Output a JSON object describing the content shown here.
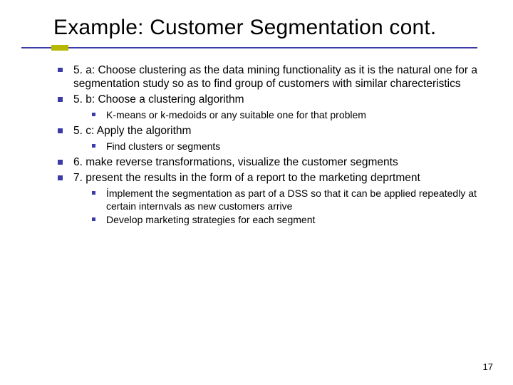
{
  "title": "Example: Customer Segmentation cont.",
  "bullets": {
    "b1": "5. a: Choose clustering as the data mining functionality as it is the natural one for a segmentation study so as to find group of customers with similar charecteristics",
    "b2": "5. b: Choose a clustering algorithm",
    "b2_1": "K-means or k-medoids or any suitable one for that problem",
    "b3": "5. c: Apply the algorithm",
    "b3_1": "Find clusters or segments",
    "b4": "6.  make reverse transformations, visualize the customer segments",
    "b5": "7.  present the results in the form of a report to the marketing deprtment",
    "b5_1": "İmplement the segmentation as part of a DSS so that it can be applied repeatedly at certain internvals as new customers arrive",
    "b5_2": "Develop marketing strategies for each segment"
  },
  "page_number": "17"
}
